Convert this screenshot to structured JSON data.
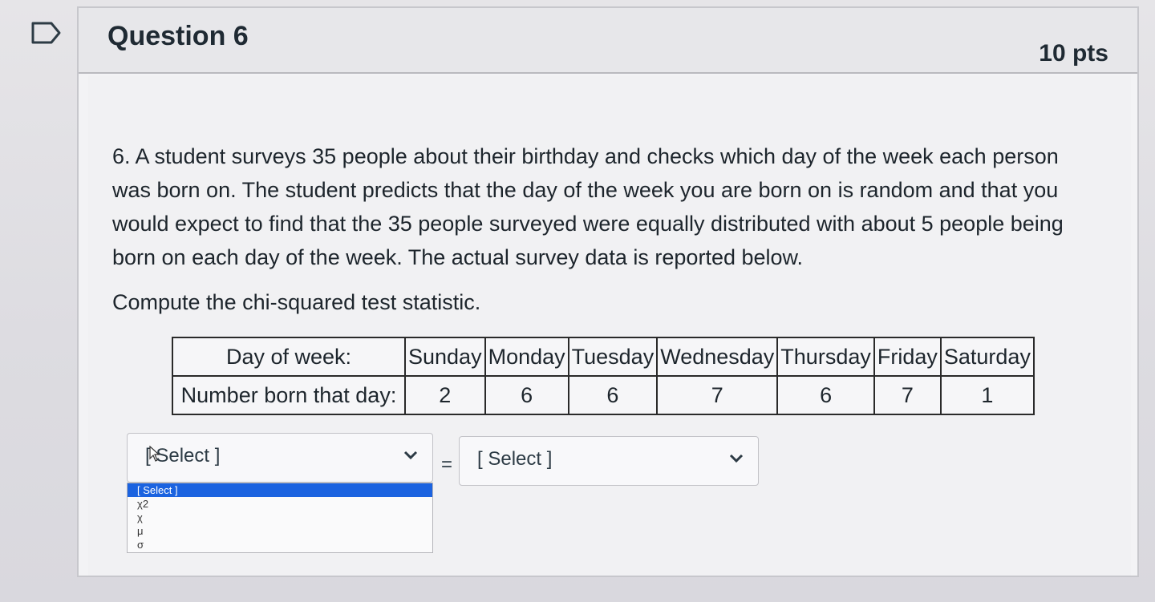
{
  "question": {
    "title": "Question 6",
    "points": "10 pts",
    "text": "6. A student surveys 35 people about their birthday and checks which day of the week each person was born on. The student predicts that the day of the week you are born on is random and that you would expect to find that the 35 people surveyed were equally distributed with about 5 people being born on each day of the week. The actual survey data is reported below.",
    "instruction": "Compute the chi-squared test statistic."
  },
  "table": {
    "header_label": "Day of week:",
    "row_label": "Number born that day:",
    "days": [
      "Sunday",
      "Monday",
      "Tuesday",
      "Wednesday",
      "Thursday",
      "Friday",
      "Saturday"
    ],
    "counts": [
      "2",
      "6",
      "6",
      "7",
      "6",
      "7",
      "1"
    ]
  },
  "answer": {
    "left_select_value": "[ Select ]",
    "equals": "=",
    "right_select_value": "[ Select ]",
    "left_options": [
      "[ Select ]",
      "χ2",
      "χ",
      "μ",
      "σ"
    ]
  },
  "icons": {
    "flag": "bookmark-flag-icon",
    "chevron": "chevron-down-icon"
  },
  "colors": {
    "highlight": "#1b63e0"
  }
}
